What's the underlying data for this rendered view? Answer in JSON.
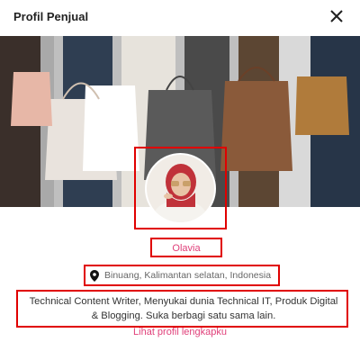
{
  "header": {
    "title": "Profil Penjual"
  },
  "profile": {
    "name": "Olavia",
    "location": "Binuang, Kalimantan selatan, Indonesia",
    "bio": "Technical Content Writer, Menyukai dunia Technical IT, Produk Digital & Blogging. Suka berbagi satu sama lain.",
    "link_label": "Lihat profil lengkapku"
  },
  "colors": {
    "highlight": "#e00000",
    "link": "#e0407a"
  },
  "icons": {
    "close": "close-icon",
    "location": "map-pin-icon"
  }
}
